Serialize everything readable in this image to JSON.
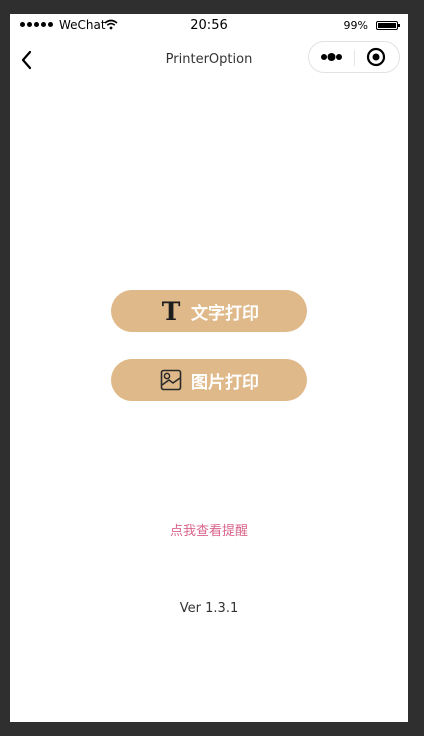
{
  "status_bar": {
    "carrier": "WeChat",
    "time": "20:56",
    "battery_percent": "99%",
    "battery_level": 0.99
  },
  "nav": {
    "title": "PrinterOption",
    "back_icon": "chevron-left-icon",
    "more_icon": "more-dots-icon",
    "close_icon": "target-circle-icon"
  },
  "actions": {
    "text_print": {
      "label": "文字打印",
      "icon": "text-t-icon"
    },
    "image_print": {
      "label": "图片打印",
      "icon": "image-icon"
    }
  },
  "reminder": {
    "label": "点我查看提醒"
  },
  "version": {
    "label": "Ver 1.3.1"
  },
  "colors": {
    "button_bg": "#dfb989",
    "button_text": "#ffffff",
    "link": "#d9648a",
    "background": "#ffffff"
  }
}
